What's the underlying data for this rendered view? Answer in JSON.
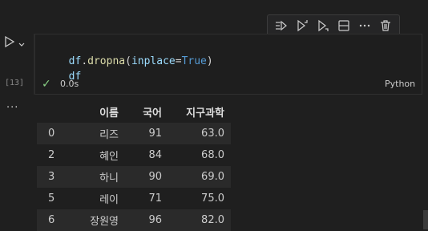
{
  "cell": {
    "execution_count": "[13]",
    "code_lines": [
      [
        {
          "t": "df",
          "c": "var"
        },
        {
          "t": ".",
          "c": "punc"
        },
        {
          "t": "dropna",
          "c": "fn"
        },
        {
          "t": "(",
          "c": "punc"
        },
        {
          "t": "inplace",
          "c": "var"
        },
        {
          "t": "=",
          "c": "punc"
        },
        {
          "t": "True",
          "c": "kw"
        },
        {
          "t": ")",
          "c": "punc"
        }
      ],
      [
        {
          "t": "df",
          "c": "var"
        }
      ]
    ],
    "status_icon": "check-icon",
    "exec_time": "0.0s",
    "language": "Python"
  },
  "toolbar": {
    "buttons": [
      "run-by-line-icon",
      "execute-above-icon",
      "execute-below-icon",
      "split-cell-icon",
      "more-icon",
      "delete-icon"
    ]
  },
  "output": {
    "dots": "...",
    "table": {
      "columns": [
        "",
        "이름",
        "국어",
        "지구과학"
      ],
      "rows": [
        [
          "0",
          "리즈",
          "91",
          "63.0"
        ],
        [
          "2",
          "혜인",
          "84",
          "68.0"
        ],
        [
          "3",
          "하니",
          "90",
          "69.0"
        ],
        [
          "5",
          "레이",
          "71",
          "75.0"
        ],
        [
          "6",
          "장원영",
          "96",
          "82.0"
        ]
      ]
    }
  },
  "colors": {
    "background": "#1f1f1f",
    "success": "#89d185",
    "keyword": "#569cd6",
    "function": "#dcdcaa",
    "variable": "#9cdcfe"
  }
}
